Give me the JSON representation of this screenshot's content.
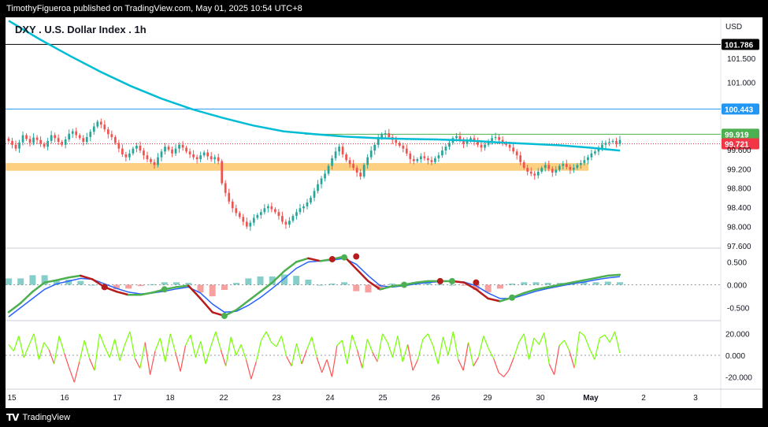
{
  "header": {
    "publisher_text": "TimothyFigueroa published on TradingView.com, May 01, 2025 10:54 UTC+8"
  },
  "footer": {
    "logo_text": "TradingView",
    "logo_mark": "TV"
  },
  "colors": {
    "up": "#26a69a",
    "down": "#ef5350",
    "ma": "#00bcd4",
    "support_zone": "#fcc76b",
    "line_black": "#000000",
    "line_blue": "#2196f3",
    "line_green": "#4caf50",
    "price_current": "#f23645",
    "macd_green": "#4caf50",
    "macd_red": "#b71c1c",
    "macd_blue": "#2962ff",
    "osc_green": "#76ff03",
    "osc_red": "#ff5252"
  },
  "chart_data": [
    {
      "type": "candlestick",
      "title": "DXY . U.S. Dollar Index . 1h",
      "currency_label": "USD",
      "x_tick_labels": [
        "15",
        "16",
        "17",
        "18",
        "22",
        "23",
        "24",
        "25",
        "26",
        "29",
        "30",
        "May",
        "2",
        "3"
      ],
      "y_tick_labels": [
        "101.500",
        "101.000",
        "99.600",
        "99.200",
        "98.800",
        "98.400",
        "98.000",
        "97.600"
      ],
      "y_tick_values": [
        101.5,
        101.0,
        99.6,
        99.2,
        98.8,
        98.4,
        98.0,
        97.6
      ],
      "ylim": [
        97.55,
        102.35
      ],
      "horizontal_levels": [
        {
          "label": "101.786",
          "value": 101.786,
          "color": "black"
        },
        {
          "label": "100.443",
          "value": 100.443,
          "color": "blue"
        },
        {
          "label": "99.919",
          "value": 99.919,
          "color": "green"
        },
        {
          "label": "99.721",
          "value": 99.721,
          "color": "red",
          "dotted": true
        }
      ],
      "support_zone": {
        "low": 99.16,
        "high": 99.32
      },
      "close_series": [
        99.78,
        99.7,
        99.62,
        99.75,
        99.9,
        99.82,
        99.74,
        99.85,
        99.8,
        99.72,
        99.66,
        99.78,
        99.9,
        99.84,
        99.76,
        99.7,
        99.81,
        99.93,
        99.98,
        99.9,
        99.84,
        99.76,
        99.86,
        99.97,
        100.08,
        100.18,
        100.12,
        100.02,
        99.92,
        99.86,
        99.74,
        99.62,
        99.5,
        99.44,
        99.52,
        99.62,
        99.68,
        99.58,
        99.48,
        99.4,
        99.34,
        99.28,
        99.44,
        99.56,
        99.66,
        99.6,
        99.52,
        99.62,
        99.7,
        99.64,
        99.56,
        99.5,
        99.44,
        99.4,
        99.48,
        99.54,
        99.46,
        99.4,
        99.44,
        99.36,
        98.9,
        98.7,
        98.52,
        98.38,
        98.28,
        98.2,
        98.1,
        98.0,
        98.08,
        98.18,
        98.24,
        98.3,
        98.38,
        98.42,
        98.36,
        98.3,
        98.22,
        98.1,
        98.04,
        98.12,
        98.22,
        98.3,
        98.38,
        98.42,
        98.5,
        98.6,
        98.74,
        98.88,
        99.0,
        99.1,
        99.26,
        99.42,
        99.56,
        99.66,
        99.5,
        99.38,
        99.3,
        99.22,
        99.12,
        99.04,
        99.28,
        99.44,
        99.58,
        99.7,
        99.84,
        99.92,
        99.94,
        99.86,
        99.8,
        99.74,
        99.68,
        99.62,
        99.52,
        99.4,
        99.36,
        99.4,
        99.46,
        99.42,
        99.38,
        99.34,
        99.42,
        99.48,
        99.58,
        99.66,
        99.74,
        99.84,
        99.88,
        99.8,
        99.72,
        99.78,
        99.84,
        99.76,
        99.7,
        99.64,
        99.7,
        99.78,
        99.84,
        99.86,
        99.8,
        99.74,
        99.7,
        99.64,
        99.56,
        99.48,
        99.34,
        99.22,
        99.14,
        99.1,
        99.06,
        99.14,
        99.22,
        99.28,
        99.2,
        99.12,
        99.18,
        99.26,
        99.3,
        99.24,
        99.18,
        99.22,
        99.28,
        99.32,
        99.38,
        99.44,
        99.52,
        99.56,
        99.62,
        99.7,
        99.74,
        99.76,
        99.78,
        99.72,
        99.8
      ],
      "moving_average": [
        102.28,
        101.9,
        101.55,
        101.22,
        100.92,
        100.66,
        100.44,
        100.26,
        100.1,
        99.98,
        99.92,
        99.87,
        99.84,
        99.82,
        99.81,
        99.79,
        99.75,
        99.72,
        99.69,
        99.64,
        99.58
      ],
      "ma_x_fraction": [
        0,
        0.05,
        0.1,
        0.15,
        0.2,
        0.25,
        0.3,
        0.35,
        0.4,
        0.45,
        0.5,
        0.55,
        0.6,
        0.65,
        0.7,
        0.75,
        0.8,
        0.85,
        0.9,
        0.95,
        1.0
      ]
    },
    {
      "type": "line",
      "indicator": "MACD",
      "y_tick_labels": [
        "0.500",
        "0.000",
        "-0.500"
      ],
      "y_tick_values": [
        0.5,
        0.0,
        -0.5
      ],
      "ylim": [
        -0.75,
        0.75
      ],
      "macd": [
        -0.6,
        -0.4,
        -0.15,
        0.05,
        0.1,
        0.16,
        0.2,
        0.12,
        -0.05,
        -0.15,
        -0.22,
        -0.22,
        -0.17,
        -0.1,
        -0.05,
        -0.02,
        -0.3,
        -0.6,
        -0.68,
        -0.55,
        -0.35,
        -0.15,
        0.05,
        0.3,
        0.5,
        0.58,
        0.52,
        0.56,
        0.62,
        0.35,
        0.08,
        -0.1,
        -0.03,
        0.0,
        0.05,
        0.08,
        0.08,
        0.08,
        0.05,
        -0.1,
        -0.3,
        -0.36,
        -0.28,
        -0.18,
        -0.1,
        -0.05,
        0.0,
        0.05,
        0.1,
        0.15,
        0.2,
        0.22
      ],
      "signal": [
        -0.7,
        -0.5,
        -0.3,
        -0.1,
        0.02,
        0.08,
        0.14,
        0.12,
        0.02,
        -0.08,
        -0.16,
        -0.2,
        -0.18,
        -0.14,
        -0.09,
        -0.05,
        -0.18,
        -0.42,
        -0.6,
        -0.58,
        -0.45,
        -0.28,
        -0.08,
        0.14,
        0.36,
        0.5,
        0.52,
        0.54,
        0.58,
        0.45,
        0.2,
        -0.02,
        -0.05,
        -0.02,
        0.02,
        0.05,
        0.07,
        0.08,
        0.06,
        -0.02,
        -0.18,
        -0.3,
        -0.3,
        -0.22,
        -0.14,
        -0.08,
        -0.03,
        0.02,
        0.06,
        0.11,
        0.15,
        0.18
      ],
      "markers": [
        {
          "x_index": 8,
          "y": -0.05,
          "type": "sell"
        },
        {
          "x_index": 13,
          "y": -0.1,
          "type": "buy"
        },
        {
          "x_index": 18,
          "y": -0.68,
          "type": "buy"
        },
        {
          "x_index": 27,
          "y": 0.56,
          "type": "sell"
        },
        {
          "x_index": 28,
          "y": 0.6,
          "type": "buy"
        },
        {
          "x_index": 29,
          "y": 0.62,
          "type": "sell"
        },
        {
          "x_index": 33,
          "y": 0.0,
          "type": "buy"
        },
        {
          "x_index": 36,
          "y": 0.08,
          "type": "sell"
        },
        {
          "x_index": 37,
          "y": 0.08,
          "type": "buy"
        },
        {
          "x_index": 39,
          "y": 0.05,
          "type": "sell"
        },
        {
          "x_index": 42,
          "y": -0.28,
          "type": "buy"
        }
      ]
    },
    {
      "type": "line",
      "indicator": "Oscillator",
      "y_tick_labels": [
        "20.000",
        "0.000",
        "-20.000"
      ],
      "y_tick_values": [
        20,
        0,
        -20
      ],
      "ylim": [
        -30,
        30
      ],
      "values": [
        10,
        4,
        18,
        -2,
        9,
        20,
        -4,
        12,
        5,
        -8,
        18,
        2,
        -12,
        -25,
        -6,
        14,
        -3,
        -14,
        20,
        8,
        -2,
        15,
        -5,
        10,
        22,
        -3,
        -12,
        12,
        -18,
        4,
        16,
        -6,
        20,
        3,
        -15,
        9,
        19,
        -2,
        13,
        -8,
        8,
        22,
        5,
        -10,
        17,
        0,
        10,
        -4,
        -22,
        -6,
        14,
        22,
        12,
        8,
        18,
        -1,
        -10,
        11,
        -8,
        5,
        17,
        -2,
        -16,
        -4,
        -20,
        9,
        14,
        -8,
        19,
        5,
        -12,
        15,
        3,
        -6,
        20,
        12,
        -2,
        18,
        -6,
        10,
        -14,
        -4,
        15,
        20,
        9,
        -8,
        17,
        0,
        22,
        -4,
        -14,
        12,
        -10,
        -2,
        18,
        6,
        -3,
        -16,
        -20,
        -14,
        -2,
        12,
        20,
        -4,
        16,
        10,
        21,
        -8,
        -18,
        9,
        14,
        4,
        -12,
        22,
        18,
        6,
        -4,
        16,
        19,
        12,
        22,
        2
      ]
    }
  ]
}
